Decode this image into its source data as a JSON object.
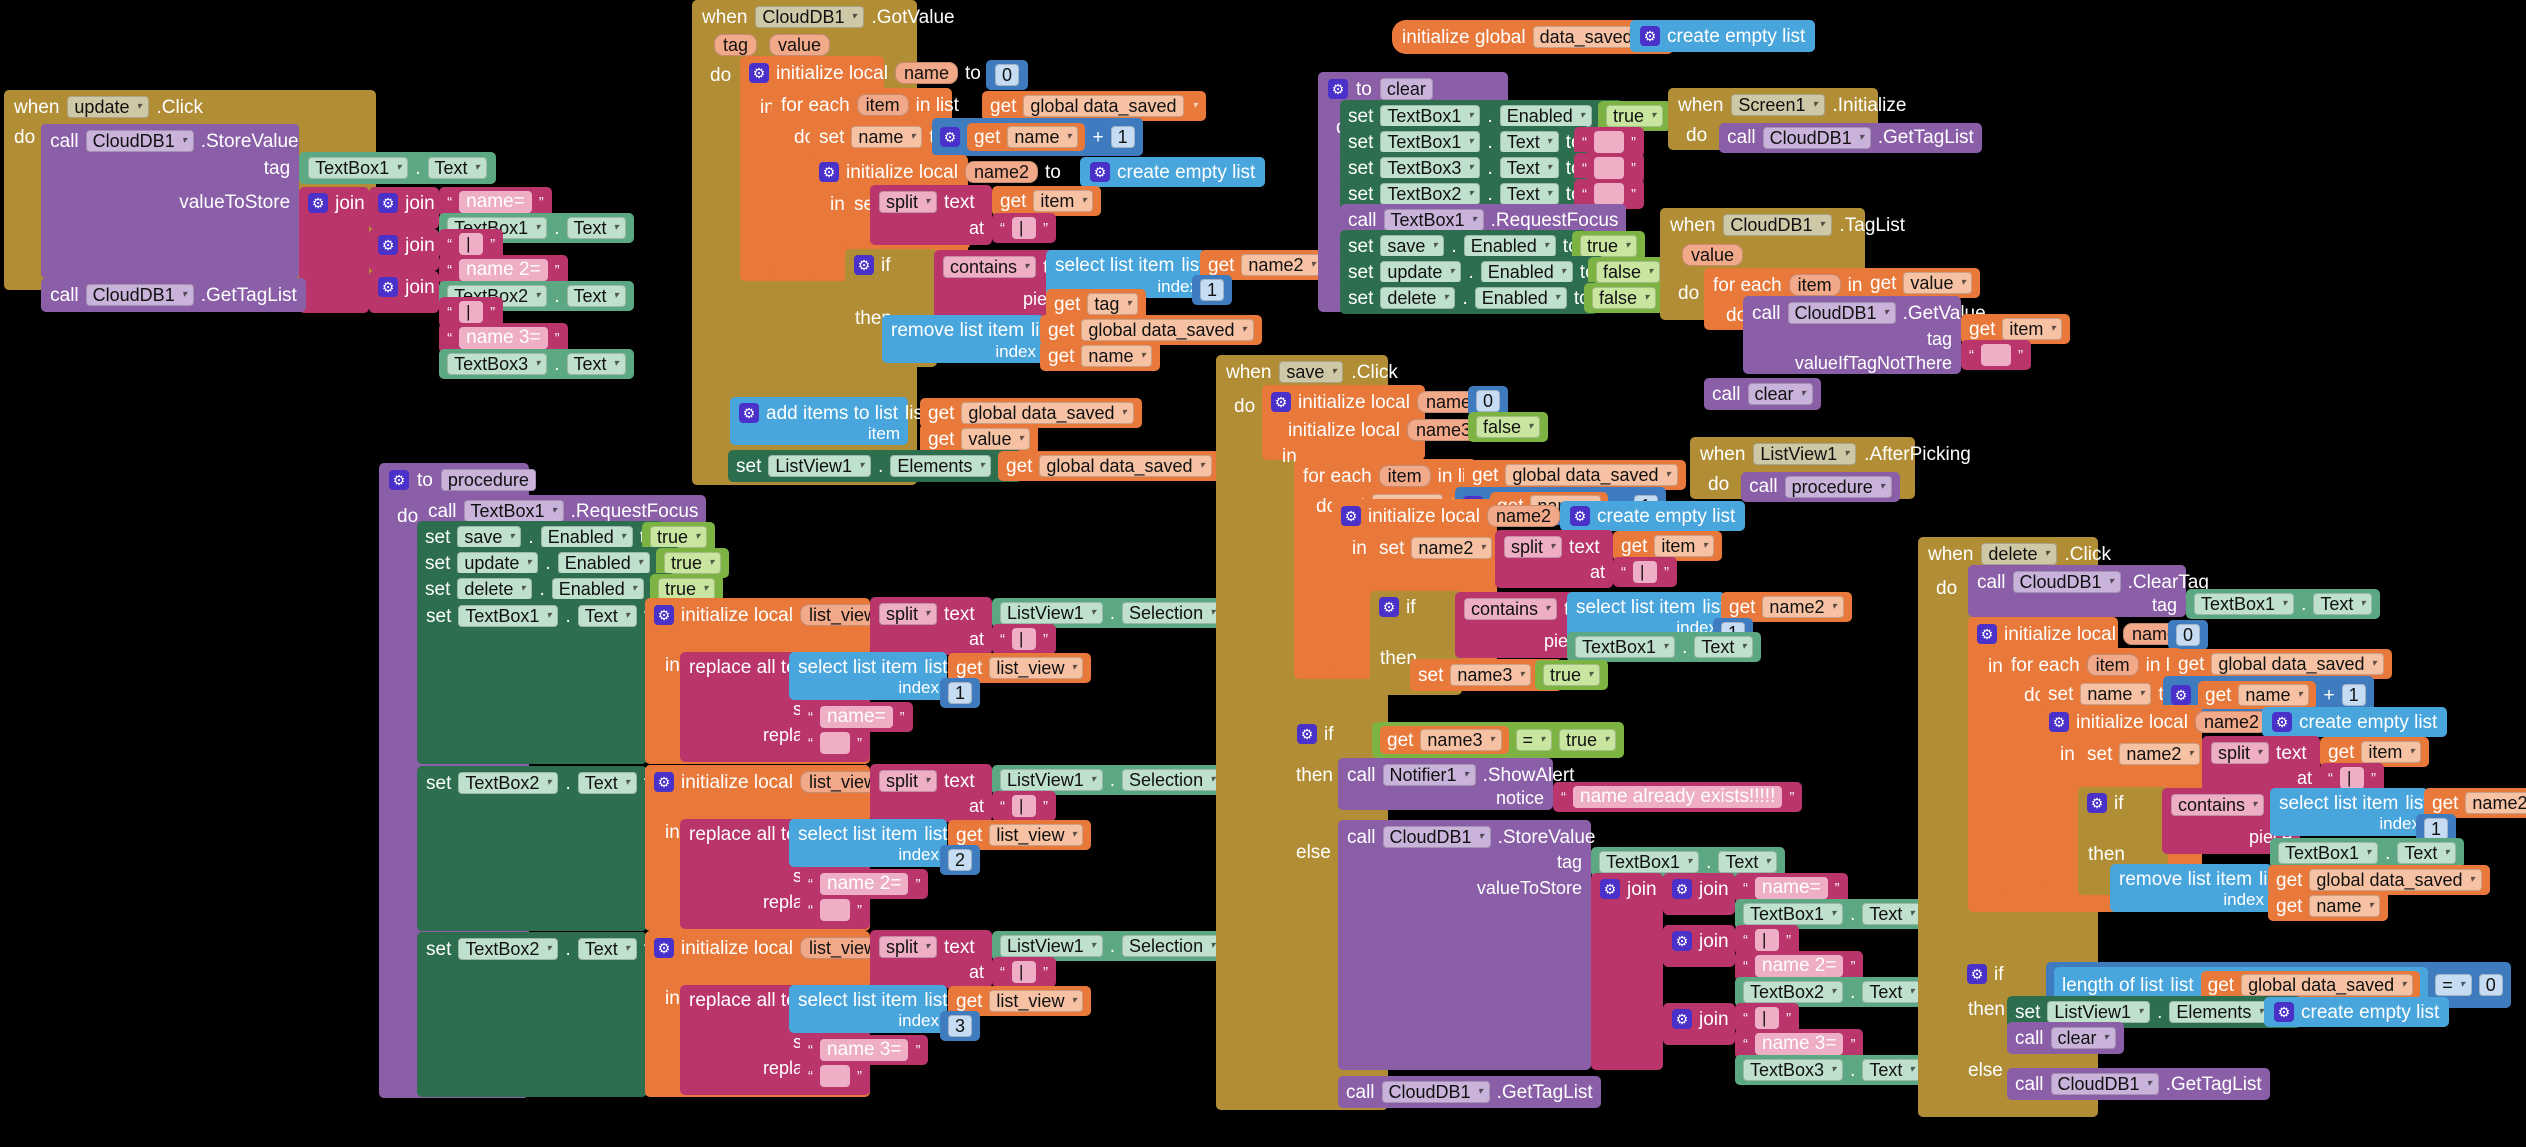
{
  "app": {
    "editor": "MIT App Inventor Blocks Editor",
    "canvas_bg": "#000000"
  },
  "palette": {
    "event": "#B18E35",
    "control": "#B18E35",
    "procedure": "#8A5FA8",
    "component_set": "#2D6E4E",
    "component_get": "#5BA882",
    "text": "#B9356B",
    "list": "#49A6DD",
    "math": "#3F7CBF",
    "logic": "#7CB342",
    "variable": "#E8793B"
  },
  "words": {
    "when": "when",
    "do": "do",
    "to": "to",
    "in": "in",
    "if": "if",
    "then": "then",
    "else": "else",
    "call": "call",
    "set": "set",
    "get": "get",
    "tag": "tag",
    "value": "value",
    "item": "item",
    "piece": "piece",
    "index": "index",
    "list": "list",
    "at": "at",
    "text": "text",
    "notice": "notice",
    "segment": "segment",
    "replacement": "replacement",
    "join": "join",
    "split": "split",
    "contains": "contains",
    "for_each": "for each",
    "in_list": "in list",
    "init_local": "initialize local",
    "init_global": "initialize global",
    "create_empty_list": "create empty list",
    "add_items_to_list": "add items to list",
    "select_list_item": "select list item",
    "remove_list_item": "remove list item",
    "length_of_list": "length of list",
    "replace_all_text": "replace all text",
    "valueToStore": "valueToStore",
    "valueIfTagNotThere": "valueIfTagNotThere",
    "plus": "+",
    "equals": "=",
    "dot": "."
  },
  "globals": {
    "name": "data_saved",
    "label": "initialize global",
    "to": "to",
    "value_block": "create empty list"
  },
  "strings": {
    "empty": "",
    "pipe": "|",
    "name_eq": "name=",
    "name2_eq": "name 2=",
    "name3_eq": "name 3=",
    "already_exists": "name already exists!!!!!"
  },
  "components": {
    "clouddb": "CloudDB1",
    "textbox1": "TextBox1",
    "textbox2": "TextBox2",
    "textbox3": "TextBox3",
    "listview1": "ListView1",
    "notifier1": "Notifier1",
    "screen1": "Screen1",
    "save": "save",
    "update": "update",
    "delete": "delete"
  },
  "props": {
    "text": "Text",
    "enabled": "Enabled",
    "elements": "Elements",
    "selection": "Selection"
  },
  "methods": {
    "storevalue": ".StoreValue",
    "gettaglist": ".GetTagList",
    "getvalue": ".GetValue",
    "cleartag": ".ClearTag",
    "requestfocus": ".RequestFocus",
    "showalert": ".ShowAlert"
  },
  "events": {
    "click": ".Click",
    "initialize": ".Initialize",
    "gotvalue": ".GotValue",
    "taglist": ".TagList",
    "afterpicking": ".AfterPicking"
  },
  "procedures": {
    "clear": "clear",
    "procedure": "procedure"
  },
  "vars": {
    "name": "name",
    "name2": "name2",
    "name3": "name3",
    "list_view": "list_view",
    "item": "item",
    "value": "value",
    "tag": "tag",
    "global_data_saved": "global data_saved"
  },
  "literals": {
    "zero": "0",
    "one": "1",
    "true": "true",
    "false": "false"
  },
  "blocks": [
    {
      "id": "update-click",
      "title": "when update .Click"
    },
    {
      "id": "gotvalue",
      "title": "when CloudDB1 .GotValue"
    },
    {
      "id": "global-data-saved",
      "title": "initialize global data_saved"
    },
    {
      "id": "to-clear",
      "title": "to clear"
    },
    {
      "id": "screen1-init",
      "title": "when Screen1 .Initialize"
    },
    {
      "id": "taglist",
      "title": "when CloudDB1 .TagList"
    },
    {
      "id": "afterpicking",
      "title": "when ListView1 .AfterPicking"
    },
    {
      "id": "to-procedure",
      "title": "to procedure"
    },
    {
      "id": "save-click",
      "title": "when save .Click"
    },
    {
      "id": "delete-click",
      "title": "when delete .Click"
    }
  ]
}
